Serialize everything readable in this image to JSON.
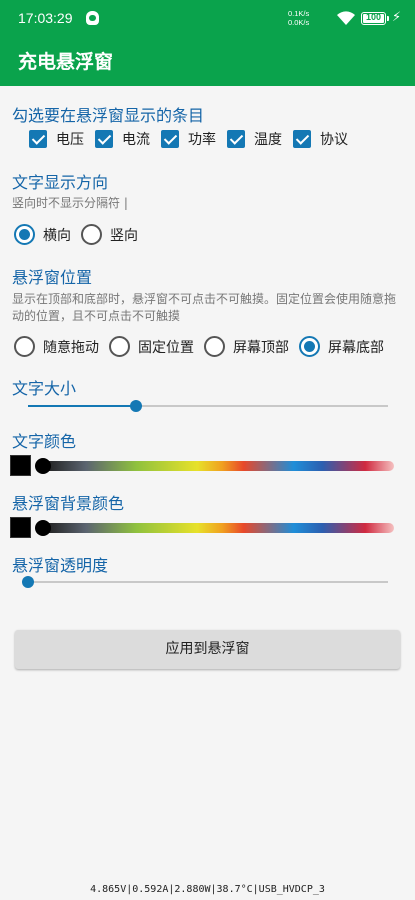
{
  "status_bar": {
    "time": "17:03:29",
    "net_up": "0.1K/s",
    "net_down": "0.0K/s",
    "battery": "100"
  },
  "app": {
    "title": "充电悬浮窗"
  },
  "items_section": {
    "title": "勾选要在悬浮窗显示的条目",
    "items": [
      {
        "label": "电压",
        "checked": true
      },
      {
        "label": "电流",
        "checked": true
      },
      {
        "label": "功率",
        "checked": true
      },
      {
        "label": "温度",
        "checked": true
      },
      {
        "label": "协议",
        "checked": true
      }
    ]
  },
  "direction_section": {
    "title": "文字显示方向",
    "hint": "竖向时不显示分隔符 |",
    "options": [
      {
        "label": "横向",
        "selected": true
      },
      {
        "label": "竖向",
        "selected": false
      }
    ]
  },
  "position_section": {
    "title": "悬浮窗位置",
    "hint": "显示在顶部和底部时，悬浮窗不可点击不可触摸。固定位置会使用随意拖动的位置，且不可点击不可触摸",
    "options": [
      {
        "label": "随意拖动",
        "selected": false
      },
      {
        "label": "固定位置",
        "selected": false
      },
      {
        "label": "屏幕顶部",
        "selected": false
      },
      {
        "label": "屏幕底部",
        "selected": true
      }
    ]
  },
  "text_size": {
    "title": "文字大小",
    "value_fraction": 0.3
  },
  "text_color": {
    "title": "文字颜色",
    "color": "#000000",
    "value_fraction": 0.0
  },
  "bg_color": {
    "title": "悬浮窗背景颜色",
    "color": "#000000",
    "value_fraction": 0.0
  },
  "opacity": {
    "title": "悬浮窗透明度",
    "value_fraction": 0.0
  },
  "apply_button": {
    "label": "应用到悬浮窗"
  },
  "footer": {
    "text": "4.865V|0.592A|2.880W|38.7°C|USB_HVDCP_3"
  },
  "colors": {
    "accent": "#1478b4",
    "header": "#0aa34c",
    "section_title": "#1565a8"
  }
}
